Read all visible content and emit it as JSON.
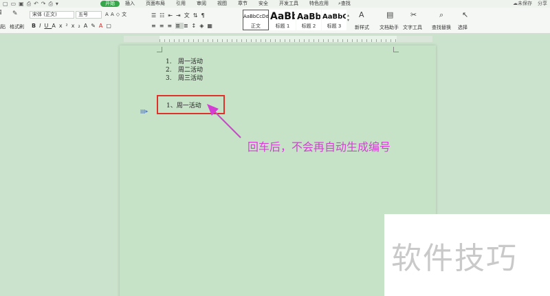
{
  "menubar": {
    "tabs": [
      {
        "label": "开始",
        "active": true
      },
      {
        "label": "插入"
      },
      {
        "label": "页面布局"
      },
      {
        "label": "引用"
      },
      {
        "label": "审阅"
      },
      {
        "label": "视图"
      },
      {
        "label": "章节"
      },
      {
        "label": "安全"
      },
      {
        "label": "开发工具"
      },
      {
        "label": "特色应用"
      }
    ],
    "search_label": "查找",
    "unsaved_label": "未保存",
    "share_label": "分享"
  },
  "ribbon": {
    "paste_label": "粘贴",
    "format_painter_label": "格式刷",
    "font_name": "宋体 (正文)",
    "font_size": "五号",
    "styles": [
      {
        "sample": "AaBbCcDd",
        "caption": "正文",
        "selected": true
      },
      {
        "sample": "AaBb",
        "caption": "标题 1"
      },
      {
        "sample": "AaBb(",
        "caption": "标题 2"
      },
      {
        "sample": "AaBbC",
        "caption": "标题 3"
      }
    ],
    "new_style_label": "新样式",
    "doc_helper_label": "文档助手",
    "text_tools_label": "文字工具",
    "find_replace_label": "查找替换",
    "select_label": "选择"
  },
  "document": {
    "numbered_list": [
      {
        "num": "1.",
        "text": "周一活动"
      },
      {
        "num": "2.",
        "text": "周二活动"
      },
      {
        "num": "3.",
        "text": "周三活动"
      }
    ],
    "typed_line": "1、周一活动"
  },
  "annotation": {
    "note": "回车后，不会再自动生成编号",
    "box_color": "#e0302a",
    "note_color": "#d33fd3"
  },
  "watermark": "软件技巧",
  "colors": {
    "accent": "#35a64a",
    "page_bg": "#c6e2c7"
  }
}
